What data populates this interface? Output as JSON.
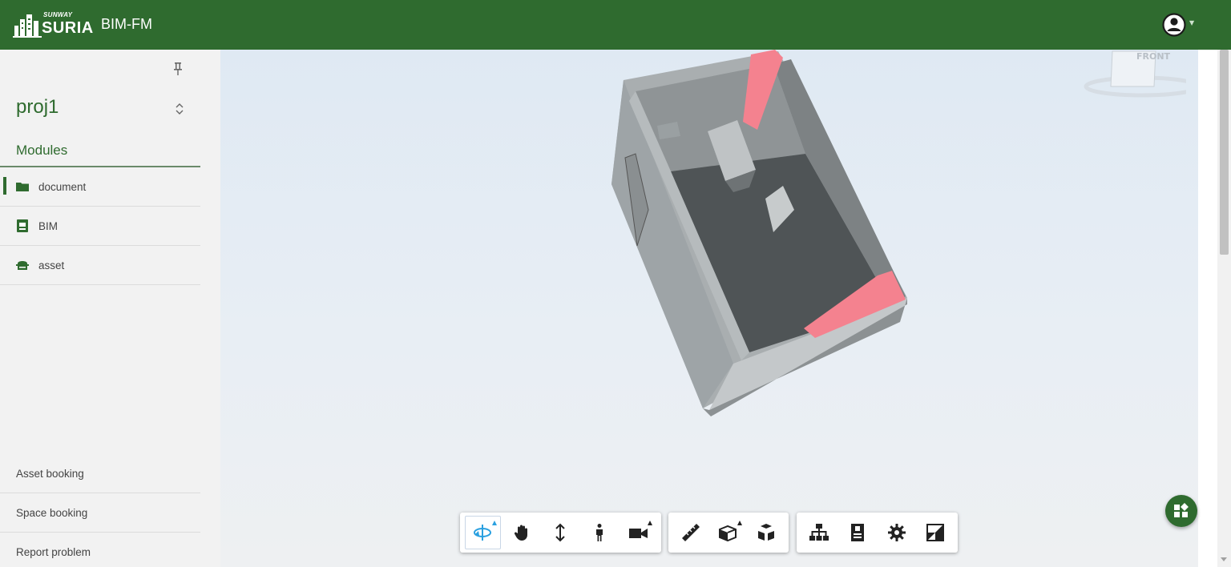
{
  "header": {
    "logo_small": "SUNWAY",
    "logo_main": "SURIA",
    "app_title": "BIM-FM",
    "background": "#2f6b2f"
  },
  "sidebar": {
    "project_name": "proj1",
    "modules_title": "Modules",
    "items": [
      {
        "label": "document",
        "icon": "folder-icon",
        "active": true
      },
      {
        "label": "BIM",
        "icon": "bim-icon",
        "active": false
      },
      {
        "label": "asset",
        "icon": "asset-icon",
        "active": false
      }
    ],
    "footer_items": [
      {
        "label": "Asset booking"
      },
      {
        "label": "Space booking"
      },
      {
        "label": "Report problem"
      }
    ]
  },
  "viewer": {
    "viewcube_label": "FRONT",
    "toolbar_groups": [
      [
        "orbit-icon",
        "pan-icon",
        "zoom-icon",
        "first-person-icon",
        "camera-icon"
      ],
      [
        "measure-icon",
        "section-icon",
        "explode-icon"
      ],
      [
        "model-browser-icon",
        "properties-icon",
        "settings-icon",
        "fullscreen-icon"
      ]
    ]
  },
  "fab": {
    "icon": "extensions-icon"
  },
  "colors": {
    "accent": "#2f6b2f",
    "highlight": "#f4828f",
    "active_tool": "#2aa0e0"
  }
}
